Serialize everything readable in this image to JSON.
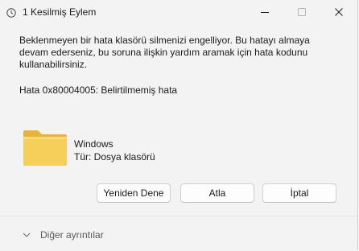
{
  "window": {
    "title": "1 Kesilmiş Eylem"
  },
  "dialog": {
    "message": "Beklenmeyen bir hata klasörü silmenizi engelliyor. Bu hatayı almaya devam ederseniz, bu soruna ilişkin yardım aramak için hata kodunu kullanabilirsiniz.",
    "error": "Hata 0x80004005: Belirtilmemiş hata",
    "item": {
      "name": "Windows",
      "type": "Tür: Dosya klasörü",
      "icon": "folder-icon"
    },
    "buttons": {
      "retry": "Yeniden Dene",
      "skip": "Atla",
      "cancel": "İptal"
    }
  },
  "footer": {
    "details_label": "Diğer ayrıntılar"
  },
  "colors": {
    "background": "#f3f3f3",
    "folder": "#f6cf5a",
    "button_bg": "#fdfdfd"
  }
}
